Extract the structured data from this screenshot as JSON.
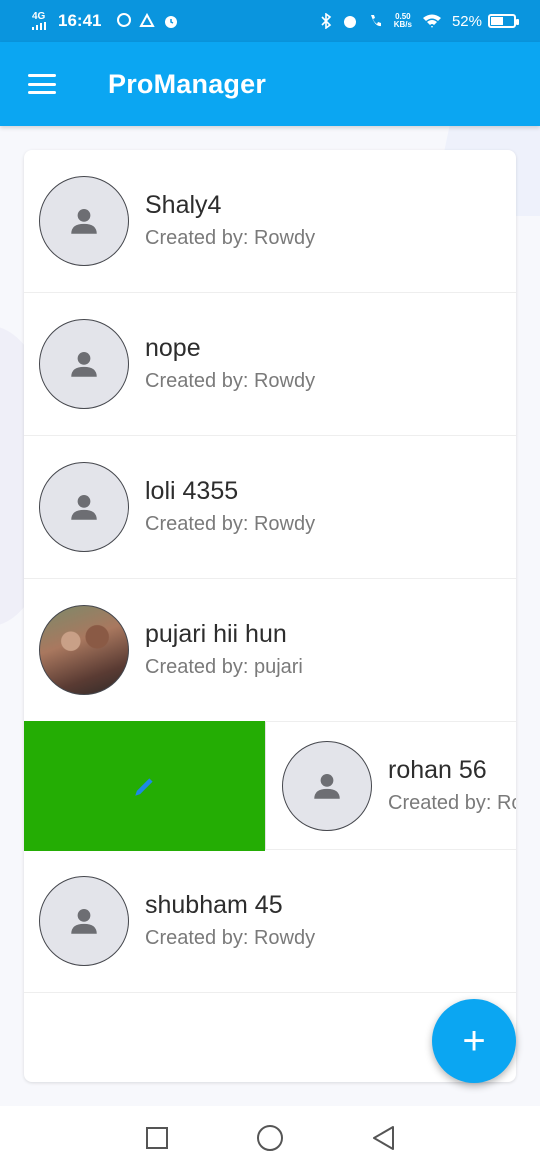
{
  "status_bar": {
    "network": "4G",
    "time": "16:41",
    "speed_value": "0.50",
    "speed_unit": "KB/s",
    "battery": "52%",
    "battery_level": 0.52
  },
  "app_bar": {
    "title": "ProManager",
    "menu_icon": "hamburger-menu-icon"
  },
  "projects": [
    {
      "name": "Shaly4",
      "creator": "Created by: Rowdy",
      "avatar": "person-icon"
    },
    {
      "name": "nope",
      "creator": "Created by: Rowdy",
      "avatar": "person-icon"
    },
    {
      "name": "loli 4355",
      "creator": "Created by: Rowdy",
      "avatar": "person-icon"
    },
    {
      "name": "pujari hii hun",
      "creator": "Created by: pujari",
      "avatar": "photo"
    },
    {
      "name": "rohan 56",
      "creator": "Created by: Rc",
      "avatar": "person-icon",
      "swiped": true
    },
    {
      "name": "shubham 45",
      "creator": "Created by: Rowdy",
      "avatar": "person-icon"
    }
  ],
  "swipe_action": {
    "icon": "pencil-icon",
    "color": "#24ad04"
  },
  "fab": {
    "label": "+",
    "color": "#0ba6f2"
  },
  "colors": {
    "primary": "#0ba6f2",
    "status_bar": "#0a95de"
  }
}
